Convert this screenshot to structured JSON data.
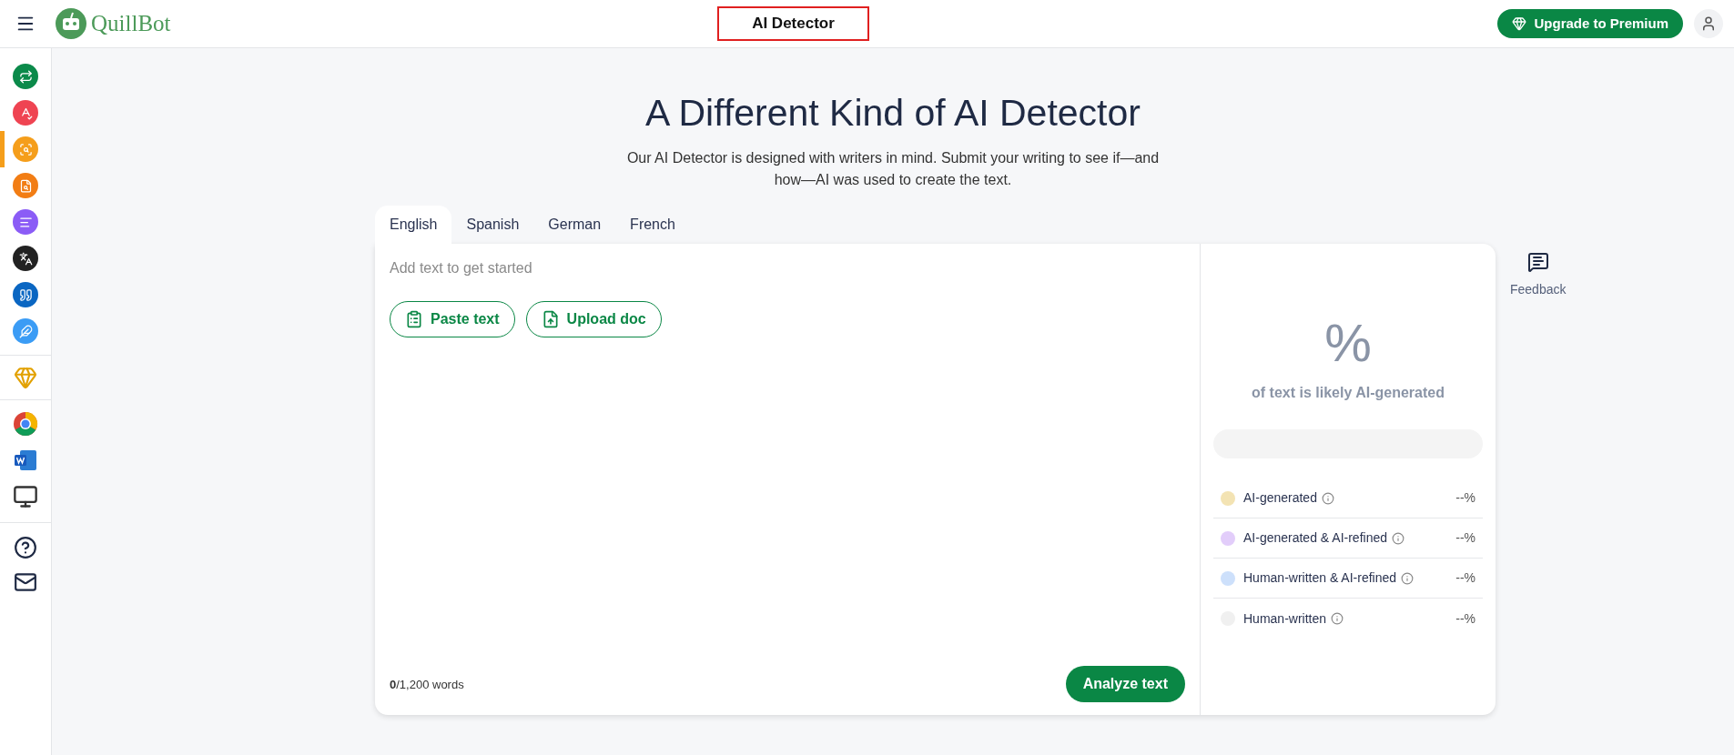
{
  "header": {
    "logo": "QuillBot",
    "title": "AI Detector",
    "upgrade_button": "Upgrade to Premium"
  },
  "sidebar": {
    "tools": [
      {
        "color": "#0b8a4a",
        "selected": false
      },
      {
        "color": "#ef4452",
        "selected": false
      },
      {
        "color": "#f59e1b",
        "selected": true
      },
      {
        "color": "#f27d14",
        "selected": false
      },
      {
        "color": "#8b5cf6",
        "selected": false
      },
      {
        "color": "#222222",
        "selected": false
      },
      {
        "color": "#0a66c2",
        "selected": false
      },
      {
        "color": "#3b9cf5",
        "selected": false
      }
    ]
  },
  "hero": {
    "title": "A Different Kind of AI Detector",
    "subtitle": "Our AI Detector is designed with writers in mind. Submit your writing to see if—and how—AI was used to create the text."
  },
  "tabs": [
    {
      "label": "English",
      "selected": true
    },
    {
      "label": "Spanish",
      "selected": false
    },
    {
      "label": "German",
      "selected": false
    },
    {
      "label": "French",
      "selected": false
    }
  ],
  "editor": {
    "placeholder": "Add text to get started",
    "paste_button": "Paste text",
    "upload_button": "Upload doc",
    "word_count": "**0**/1,200 words",
    "analyze_button": "Analyze text"
  },
  "result": {
    "percent": "%",
    "caption": "of text is likely AI-generated",
    "legend": [
      {
        "label": "AI-generated",
        "value": "--%",
        "color": "#f3e3b3"
      },
      {
        "label": "AI-generated & AI-refined",
        "value": "--%",
        "color": "#e2cdfa"
      },
      {
        "label": "Human-written & AI-refined",
        "value": "--%",
        "color": "#cde0fb"
      },
      {
        "label": "Human-written",
        "value": "--%",
        "color": "#f0f0f0"
      }
    ]
  },
  "feedback": {
    "label": "Feedback"
  }
}
